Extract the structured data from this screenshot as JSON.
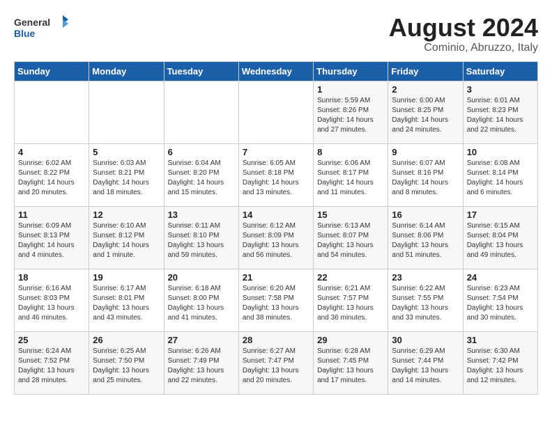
{
  "header": {
    "logo_general": "General",
    "logo_blue": "Blue",
    "title": "August 2024",
    "subtitle": "Cominio, Abruzzo, Italy"
  },
  "weekdays": [
    "Sunday",
    "Monday",
    "Tuesday",
    "Wednesday",
    "Thursday",
    "Friday",
    "Saturday"
  ],
  "weeks": [
    [
      {
        "day": "",
        "info": ""
      },
      {
        "day": "",
        "info": ""
      },
      {
        "day": "",
        "info": ""
      },
      {
        "day": "",
        "info": ""
      },
      {
        "day": "1",
        "info": "Sunrise: 5:59 AM\nSunset: 8:26 PM\nDaylight: 14 hours\nand 27 minutes."
      },
      {
        "day": "2",
        "info": "Sunrise: 6:00 AM\nSunset: 8:25 PM\nDaylight: 14 hours\nand 24 minutes."
      },
      {
        "day": "3",
        "info": "Sunrise: 6:01 AM\nSunset: 8:23 PM\nDaylight: 14 hours\nand 22 minutes."
      }
    ],
    [
      {
        "day": "4",
        "info": "Sunrise: 6:02 AM\nSunset: 8:22 PM\nDaylight: 14 hours\nand 20 minutes."
      },
      {
        "day": "5",
        "info": "Sunrise: 6:03 AM\nSunset: 8:21 PM\nDaylight: 14 hours\nand 18 minutes."
      },
      {
        "day": "6",
        "info": "Sunrise: 6:04 AM\nSunset: 8:20 PM\nDaylight: 14 hours\nand 15 minutes."
      },
      {
        "day": "7",
        "info": "Sunrise: 6:05 AM\nSunset: 8:18 PM\nDaylight: 14 hours\nand 13 minutes."
      },
      {
        "day": "8",
        "info": "Sunrise: 6:06 AM\nSunset: 8:17 PM\nDaylight: 14 hours\nand 11 minutes."
      },
      {
        "day": "9",
        "info": "Sunrise: 6:07 AM\nSunset: 8:16 PM\nDaylight: 14 hours\nand 8 minutes."
      },
      {
        "day": "10",
        "info": "Sunrise: 6:08 AM\nSunset: 8:14 PM\nDaylight: 14 hours\nand 6 minutes."
      }
    ],
    [
      {
        "day": "11",
        "info": "Sunrise: 6:09 AM\nSunset: 8:13 PM\nDaylight: 14 hours\nand 4 minutes."
      },
      {
        "day": "12",
        "info": "Sunrise: 6:10 AM\nSunset: 8:12 PM\nDaylight: 14 hours\nand 1 minute."
      },
      {
        "day": "13",
        "info": "Sunrise: 6:11 AM\nSunset: 8:10 PM\nDaylight: 13 hours\nand 59 minutes."
      },
      {
        "day": "14",
        "info": "Sunrise: 6:12 AM\nSunset: 8:09 PM\nDaylight: 13 hours\nand 56 minutes."
      },
      {
        "day": "15",
        "info": "Sunrise: 6:13 AM\nSunset: 8:07 PM\nDaylight: 13 hours\nand 54 minutes."
      },
      {
        "day": "16",
        "info": "Sunrise: 6:14 AM\nSunset: 8:06 PM\nDaylight: 13 hours\nand 51 minutes."
      },
      {
        "day": "17",
        "info": "Sunrise: 6:15 AM\nSunset: 8:04 PM\nDaylight: 13 hours\nand 49 minutes."
      }
    ],
    [
      {
        "day": "18",
        "info": "Sunrise: 6:16 AM\nSunset: 8:03 PM\nDaylight: 13 hours\nand 46 minutes."
      },
      {
        "day": "19",
        "info": "Sunrise: 6:17 AM\nSunset: 8:01 PM\nDaylight: 13 hours\nand 43 minutes."
      },
      {
        "day": "20",
        "info": "Sunrise: 6:18 AM\nSunset: 8:00 PM\nDaylight: 13 hours\nand 41 minutes."
      },
      {
        "day": "21",
        "info": "Sunrise: 6:20 AM\nSunset: 7:58 PM\nDaylight: 13 hours\nand 38 minutes."
      },
      {
        "day": "22",
        "info": "Sunrise: 6:21 AM\nSunset: 7:57 PM\nDaylight: 13 hours\nand 36 minutes."
      },
      {
        "day": "23",
        "info": "Sunrise: 6:22 AM\nSunset: 7:55 PM\nDaylight: 13 hours\nand 33 minutes."
      },
      {
        "day": "24",
        "info": "Sunrise: 6:23 AM\nSunset: 7:54 PM\nDaylight: 13 hours\nand 30 minutes."
      }
    ],
    [
      {
        "day": "25",
        "info": "Sunrise: 6:24 AM\nSunset: 7:52 PM\nDaylight: 13 hours\nand 28 minutes."
      },
      {
        "day": "26",
        "info": "Sunrise: 6:25 AM\nSunset: 7:50 PM\nDaylight: 13 hours\nand 25 minutes."
      },
      {
        "day": "27",
        "info": "Sunrise: 6:26 AM\nSunset: 7:49 PM\nDaylight: 13 hours\nand 22 minutes."
      },
      {
        "day": "28",
        "info": "Sunrise: 6:27 AM\nSunset: 7:47 PM\nDaylight: 13 hours\nand 20 minutes."
      },
      {
        "day": "29",
        "info": "Sunrise: 6:28 AM\nSunset: 7:45 PM\nDaylight: 13 hours\nand 17 minutes."
      },
      {
        "day": "30",
        "info": "Sunrise: 6:29 AM\nSunset: 7:44 PM\nDaylight: 13 hours\nand 14 minutes."
      },
      {
        "day": "31",
        "info": "Sunrise: 6:30 AM\nSunset: 7:42 PM\nDaylight: 13 hours\nand 12 minutes."
      }
    ]
  ]
}
